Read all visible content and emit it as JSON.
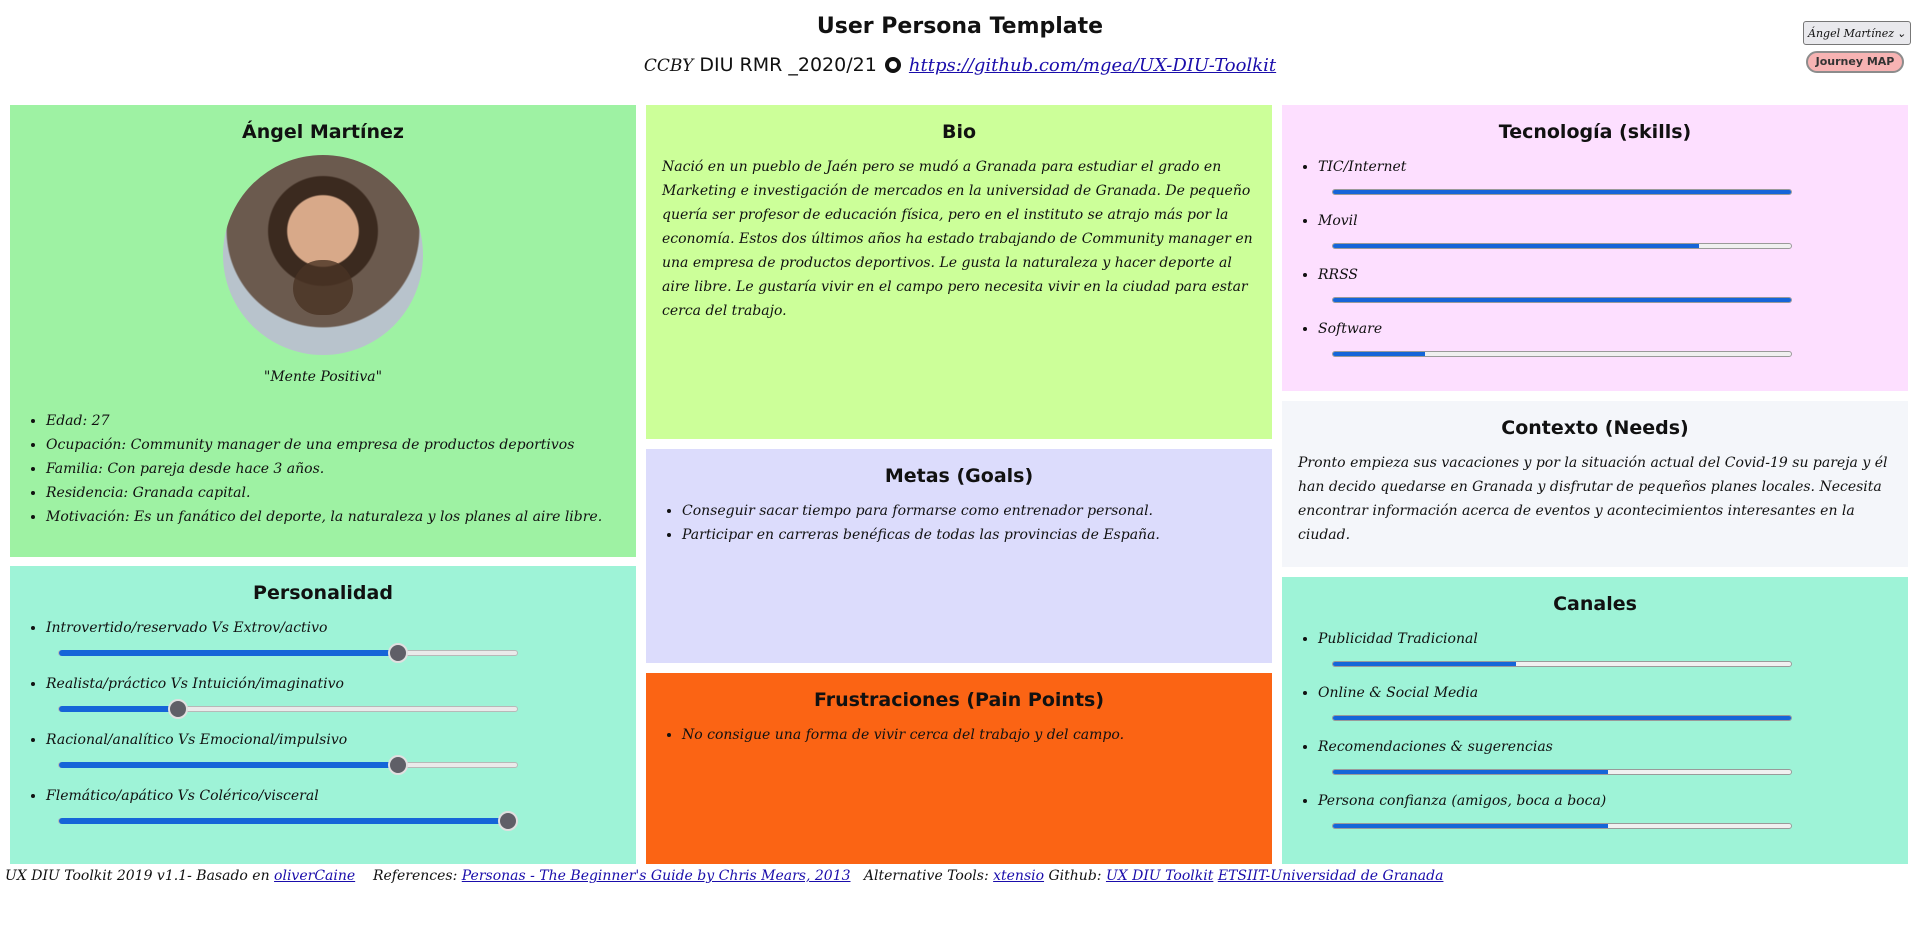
{
  "header": {
    "title": "User Persona Template",
    "license": "CCBY",
    "course": "DIU RMR _2020/21",
    "repo_link": "https://github.com/mgea/UX-DIU-Toolkit"
  },
  "controls": {
    "persona_select_value": "Ángel Martínez",
    "journey_button": "Journey MAP"
  },
  "profile": {
    "name": "Ángel Martínez",
    "quote": "\"Mente Positiva\"",
    "details": [
      "Edad: 27",
      "Ocupación: Community manager de una empresa de productos deportivos",
      "Familia: Con pareja desde hace 3 años.",
      "Residencia: Granada capital.",
      "Motivación: Es un fanático del deporte, la naturaleza y los planes al aire libre."
    ]
  },
  "bio": {
    "title": "Bio",
    "text": "Nació en un pueblo de Jaén pero se mudó a Granada para estudiar el grado en Marketing e investigación de mercados en la universidad de Granada. De pequeño quería ser profesor de educación física, pero en el instituto se atrajo más por la economía. Estos dos últimos años ha estado trabajando de Community manager en una empresa de productos deportivos. Le gusta la naturaleza y hacer deporte al aire libre. Le gustaría vivir en el campo pero necesita vivir en la ciudad para estar cerca del trabajo."
  },
  "goals": {
    "title": "Metas (Goals)",
    "items": [
      "Conseguir sacar tiempo para formarse como entrenador personal.",
      "Participar en carreras benéficas de todas las provincias de España."
    ]
  },
  "frustrations": {
    "title": "Frustraciones (Pain Points)",
    "items": [
      "No consigue una forma de vivir cerca del trabajo y del campo."
    ]
  },
  "personality": {
    "title": "Personalidad",
    "traits": [
      {
        "label": "Introvertido/reservado Vs Extrov/activo",
        "value": 0.74
      },
      {
        "label": "Realista/práctico Vs Intuición/imaginativo",
        "value": 0.26
      },
      {
        "label": "Racional/analítico Vs Emocional/impulsivo",
        "value": 0.74
      },
      {
        "label": "Flemático/apático Vs Colérico/visceral",
        "value": 0.98
      }
    ]
  },
  "technology": {
    "title": "Tecnología (skills)",
    "skills": [
      {
        "label": "TIC/Internet",
        "value": 1.0
      },
      {
        "label": "Movil",
        "value": 0.8
      },
      {
        "label": "RRSS",
        "value": 1.0
      },
      {
        "label": "Software",
        "value": 0.2
      }
    ]
  },
  "context": {
    "title": "Contexto (Needs)",
    "text": "Pronto empieza sus vacaciones y por la situación actual del Covid-19 su pareja y él han decido quedarse en Granada y disfrutar de pequeños planes locales. Necesita encontrar información acerca de eventos y acontecimientos interesantes en la ciudad."
  },
  "channels": {
    "title": "Canales",
    "items": [
      {
        "label": "Publicidad Tradicional",
        "value": 0.4
      },
      {
        "label": "Online & Social Media",
        "value": 1.0
      },
      {
        "label": "Recomendaciones & sugerencias",
        "value": 0.6
      },
      {
        "label": "Persona confianza (amigos, boca a boca)",
        "value": 0.6
      }
    ]
  },
  "footer": {
    "prefix": "UX DIU Toolkit 2019 v1.1- Basado en",
    "link_olivercaine": "oliverCaine",
    "references_label": "References:",
    "link_personas": "Personas - The Beginner's Guide by Chris Mears, 2013",
    "alt_tools_label": "Alternative Tools:",
    "link_xtensio": "xtensio",
    "github_label": "Github:",
    "link_toolkit": "UX DIU Toolkit",
    "link_etsiit": "ETSIIT-Universidad de Granada"
  },
  "colors": {
    "profile_bg": "#9ef2a3",
    "personality_bg": "#9ef3d7",
    "bio_bg": "#ccff99",
    "goals_bg": "#dcdcfc",
    "frustrations_bg": "#fb6414",
    "technology_bg": "#fddfff",
    "context_bg": "#f4f6fa",
    "channels_bg": "#9ef3d7",
    "accent": "#1565d8"
  }
}
